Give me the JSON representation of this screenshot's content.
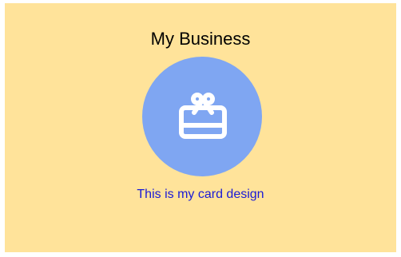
{
  "card": {
    "title": "My Business",
    "caption": "This is my card design",
    "icon": "gift-card-icon",
    "colors": {
      "background": "#ffe39a",
      "icon_circle": "#7fa6f2",
      "caption_text": "#1a1ad6",
      "title_text": "#000000"
    }
  }
}
